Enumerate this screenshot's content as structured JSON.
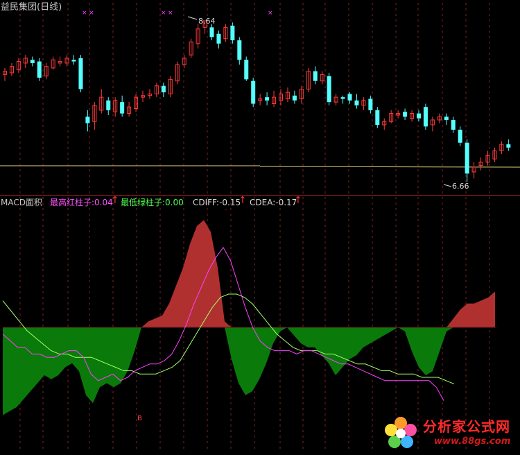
{
  "top_panel": {
    "title": "益民集团(日线)",
    "high_marker": "8.64",
    "low_marker": "6.66"
  },
  "bottom_panel": {
    "indicator_name": "MACD面积",
    "max_red_label": "最高红柱子:",
    "max_red_value": "0.04",
    "min_green_label": "最低绿柱子:",
    "min_green_value": "0.00",
    "cdiff_label": "CDIFF:",
    "cdiff_value": "-0.15",
    "cdea_label": "CDEA:",
    "cdea_value": "-0.17",
    "arrow": "↑",
    "buy_marker": "B"
  },
  "watermark": {
    "brand": "分析家公式网",
    "url": "www.88gs.com"
  },
  "colors": {
    "background": "#000000",
    "up_candle": "#ff3c3c",
    "down_candle": "#54ffff",
    "title": "#c8c8c8",
    "red_area": "#b03030",
    "green_area": "#0a7a0a",
    "diff_line": "#ff40ff",
    "dea_line": "#a6ff6a",
    "ma_line": "#e6d480",
    "grid": "#8a1f1f",
    "max_red_color": "#ff50ff",
    "min_green_color": "#50ff50"
  },
  "chart_data": {
    "type": "candlestick",
    "price_high": 8.64,
    "price_low": 6.66,
    "candles": [
      [
        7.98,
        8.02,
        7.9,
        8.06
      ],
      [
        8.0,
        8.08,
        7.96,
        8.12
      ],
      [
        8.04,
        8.14,
        8.0,
        8.18
      ],
      [
        8.12,
        8.18,
        8.06,
        8.22
      ],
      [
        8.16,
        8.12,
        8.08,
        8.2
      ],
      [
        8.14,
        7.94,
        7.9,
        8.18
      ],
      [
        7.96,
        8.08,
        7.92,
        8.12
      ],
      [
        8.06,
        8.16,
        8.04,
        8.2
      ],
      [
        8.12,
        8.14,
        8.08,
        8.2
      ],
      [
        8.12,
        8.18,
        8.08,
        8.22
      ],
      [
        8.16,
        8.14,
        8.1,
        8.22
      ],
      [
        8.18,
        7.8,
        7.76,
        8.22
      ],
      [
        7.46,
        7.38,
        7.28,
        7.54
      ],
      [
        7.4,
        7.6,
        7.3,
        7.64
      ],
      [
        7.54,
        7.7,
        7.5,
        7.8
      ],
      [
        7.66,
        7.54,
        7.48,
        7.7
      ],
      [
        7.52,
        7.66,
        7.46,
        7.7
      ],
      [
        7.64,
        7.5,
        7.46,
        7.72
      ],
      [
        7.5,
        7.58,
        7.46,
        7.64
      ],
      [
        7.56,
        7.7,
        7.52,
        7.74
      ],
      [
        7.7,
        7.72,
        7.64,
        7.78
      ],
      [
        7.72,
        7.74,
        7.68,
        7.8
      ],
      [
        7.74,
        7.84,
        7.7,
        7.88
      ],
      [
        7.84,
        7.76,
        7.7,
        7.88
      ],
      [
        7.74,
        7.92,
        7.7,
        7.96
      ],
      [
        7.9,
        8.1,
        7.86,
        8.14
      ],
      [
        8.1,
        8.18,
        8.06,
        8.22
      ],
      [
        8.22,
        8.38,
        8.18,
        8.42
      ],
      [
        8.36,
        8.54,
        8.3,
        8.6
      ],
      [
        8.56,
        8.64,
        8.48,
        8.64
      ],
      [
        8.56,
        8.44,
        8.4,
        8.6
      ],
      [
        8.48,
        8.36,
        8.3,
        8.52
      ],
      [
        8.42,
        8.56,
        8.38,
        8.6
      ],
      [
        8.58,
        8.4,
        8.36,
        8.62
      ],
      [
        8.4,
        8.16,
        8.1,
        8.44
      ],
      [
        8.16,
        7.92,
        7.9,
        8.2
      ],
      [
        7.9,
        7.62,
        7.58,
        7.94
      ],
      [
        7.66,
        7.68,
        7.6,
        7.74
      ],
      [
        7.7,
        7.66,
        7.6,
        7.76
      ],
      [
        7.62,
        7.7,
        7.58,
        7.78
      ],
      [
        7.66,
        7.74,
        7.6,
        7.8
      ],
      [
        7.68,
        7.76,
        7.64,
        7.82
      ],
      [
        7.72,
        7.66,
        7.62,
        7.78
      ],
      [
        7.68,
        7.8,
        7.62,
        7.84
      ],
      [
        7.8,
        8.02,
        7.76,
        8.06
      ],
      [
        8.02,
        7.9,
        7.86,
        8.08
      ],
      [
        7.9,
        7.98,
        7.86,
        8.02
      ],
      [
        7.96,
        7.64,
        7.6,
        8.0
      ],
      [
        7.64,
        7.7,
        7.6,
        7.74
      ],
      [
        7.7,
        7.68,
        7.62,
        7.72
      ],
      [
        7.74,
        7.66,
        7.62,
        7.76
      ],
      [
        7.66,
        7.6,
        7.56,
        7.74
      ],
      [
        7.6,
        7.66,
        7.54,
        7.7
      ],
      [
        7.68,
        7.54,
        7.5,
        7.72
      ],
      [
        7.54,
        7.36,
        7.32,
        7.58
      ],
      [
        7.36,
        7.4,
        7.3,
        7.44
      ],
      [
        7.4,
        7.5,
        7.38,
        7.54
      ],
      [
        7.48,
        7.5,
        7.44,
        7.54
      ],
      [
        7.52,
        7.46,
        7.42,
        7.56
      ],
      [
        7.44,
        7.5,
        7.4,
        7.54
      ],
      [
        7.5,
        7.44,
        7.4,
        7.54
      ],
      [
        7.58,
        7.34,
        7.3,
        7.62
      ],
      [
        7.36,
        7.42,
        7.28,
        7.46
      ],
      [
        7.42,
        7.46,
        7.38,
        7.5
      ],
      [
        7.46,
        7.42,
        7.36,
        7.5
      ],
      [
        7.42,
        7.3,
        7.26,
        7.46
      ],
      [
        7.3,
        7.14,
        7.1,
        7.34
      ],
      [
        7.14,
        6.76,
        6.66,
        7.18
      ],
      [
        6.78,
        6.84,
        6.7,
        6.9
      ],
      [
        6.86,
        6.9,
        6.8,
        6.96
      ],
      [
        6.9,
        6.98,
        6.86,
        7.04
      ],
      [
        6.94,
        7.04,
        6.9,
        7.08
      ],
      [
        7.04,
        7.12,
        7.0,
        7.16
      ],
      [
        7.12,
        7.08,
        7.04,
        7.18
      ]
    ],
    "ma_value": 7.02,
    "macd_area": [
      -0.22,
      -0.21,
      -0.2,
      -0.18,
      -0.16,
      -0.14,
      -0.12,
      -0.13,
      -0.12,
      -0.1,
      -0.09,
      -0.11,
      -0.17,
      -0.19,
      -0.15,
      -0.14,
      -0.15,
      -0.14,
      -0.11,
      -0.06,
      0.0,
      0.02,
      0.03,
      0.04,
      0.08,
      0.14,
      0.2,
      0.28,
      0.34,
      0.36,
      0.32,
      0.2,
      0.02,
      -0.08,
      -0.14,
      -0.17,
      -0.16,
      -0.13,
      -0.09,
      -0.04,
      -0.01,
      0.0,
      -0.02,
      -0.04,
      -0.05,
      -0.05,
      -0.07,
      -0.09,
      -0.12,
      -0.1,
      -0.08,
      -0.07,
      -0.05,
      -0.04,
      -0.03,
      -0.02,
      -0.01,
      0.0,
      -0.01,
      -0.06,
      -0.1,
      -0.12,
      -0.11,
      -0.06,
      -0.01,
      0.03,
      0.06,
      0.08,
      0.08,
      0.09,
      0.1,
      0.12
    ],
    "diff": [
      -0.02,
      -0.04,
      -0.06,
      -0.06,
      -0.08,
      -0.08,
      -0.09,
      -0.09,
      -0.08,
      -0.07,
      -0.07,
      -0.09,
      -0.14,
      -0.16,
      -0.15,
      -0.14,
      -0.16,
      -0.15,
      -0.13,
      -0.12,
      -0.11,
      -0.11,
      -0.1,
      -0.08,
      -0.04,
      0.01,
      0.07,
      0.12,
      0.17,
      0.21,
      0.24,
      0.2,
      0.13,
      0.06,
      0.0,
      -0.04,
      -0.06,
      -0.07,
      -0.07,
      -0.07,
      -0.08,
      -0.07,
      -0.07,
      -0.08,
      -0.09,
      -0.1,
      -0.11,
      -0.11,
      -0.12,
      -0.13,
      -0.14,
      -0.15,
      -0.16,
      -0.16,
      -0.16,
      -0.16,
      -0.16,
      -0.16,
      -0.16,
      -0.18,
      -0.22
    ],
    "dea": [
      0.08,
      0.05,
      0.02,
      -0.01,
      -0.03,
      -0.05,
      -0.07,
      -0.08,
      -0.08,
      -0.09,
      -0.09,
      -0.09,
      -0.1,
      -0.11,
      -0.12,
      -0.13,
      -0.13,
      -0.14,
      -0.14,
      -0.14,
      -0.13,
      -0.12,
      -0.1,
      -0.06,
      -0.02,
      0.02,
      0.06,
      0.09,
      0.1,
      0.1,
      0.09,
      0.07,
      0.04,
      0.01,
      -0.02,
      -0.04,
      -0.06,
      -0.07,
      -0.07,
      -0.07,
      -0.08,
      -0.08,
      -0.09,
      -0.1,
      -0.11,
      -0.11,
      -0.12,
      -0.13,
      -0.13,
      -0.14,
      -0.14,
      -0.14,
      -0.15,
      -0.15,
      -0.15,
      -0.16,
      -0.17
    ],
    "macd_range": [
      -0.24,
      0.4
    ]
  }
}
